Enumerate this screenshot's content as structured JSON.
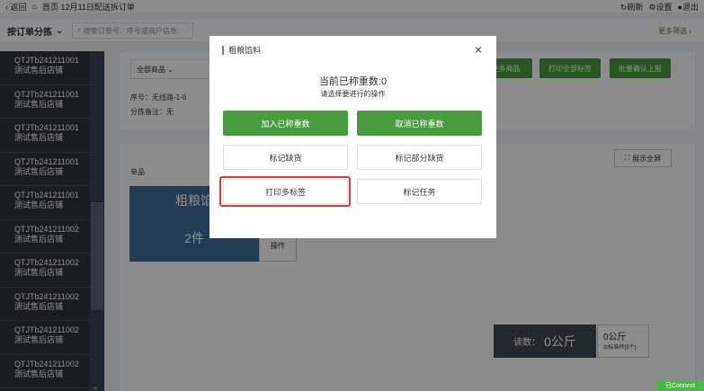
{
  "topbar": {
    "back_label": "返回",
    "home_icon": "home-icon",
    "title": "首页 12月11日配送拆订单",
    "refresh_label": "刷新",
    "settings_label": "设置",
    "exit_label": "退出"
  },
  "filter": {
    "sort_label": "按订单分拣",
    "search_placeholder": "搜索订单号、序号或商户信息",
    "more_label": "更多筛选"
  },
  "sidebar": {
    "items": [
      {
        "code": "QTJTb241211001",
        "name": "测试售后店铺"
      },
      {
        "code": "QTJTb241211001",
        "name": "测试售后店铺"
      },
      {
        "code": "QTJTb241211001",
        "name": "测试售后店铺"
      },
      {
        "code": "QTJTb241211001",
        "name": "测试售后店铺"
      },
      {
        "code": "QTJTb241211001",
        "name": "测试售后店铺"
      },
      {
        "code": "QTJTb241211002",
        "name": "测试售后店铺"
      },
      {
        "code": "QTJTb241211002",
        "name": "测试售后店铺"
      },
      {
        "code": "QTJTb241211002",
        "name": "测试售后店铺"
      },
      {
        "code": "QTJTb241211002",
        "name": "测试售后店铺"
      },
      {
        "code": "QTJTb241211002",
        "name": "测试售后店铺"
      }
    ]
  },
  "order": {
    "goods_select": "全部商品",
    "seq_line": "序号：无线路-1-6",
    "note_line": "分拣备注：无",
    "btn_more": "更多商品",
    "btn_print_all": "打印全部标签",
    "btn_batch": "批量确认上报"
  },
  "panel": {
    "fullscreen_label": "展示全屏",
    "single_label": "单品",
    "tile_name": "粗粮馅",
    "tile_qty": "2件",
    "op_label": "操作"
  },
  "scale": {
    "reading_label": "读数：",
    "reading_value": "0公斤",
    "tare_value": "0公斤",
    "tare_label": "标准秤(5个)"
  },
  "conn_label": "已Connect",
  "modal": {
    "title": "粗粮馅料",
    "current": "当前已称重数:0",
    "hint": "请选择要进行的操作",
    "btn_add": "加入已称重数",
    "btn_cancel": "取消已称重数",
    "btn_mark_short": "标记缺货",
    "btn_mark_partial": "标记部分缺货",
    "btn_print_multi": "打印多标签",
    "btn_mark_task": "标记任务"
  },
  "colors": {
    "accent": "#4a9d3f",
    "sidebar": "#2d3540",
    "tile": "#3e6d9c",
    "highlight": "#e0382f"
  }
}
